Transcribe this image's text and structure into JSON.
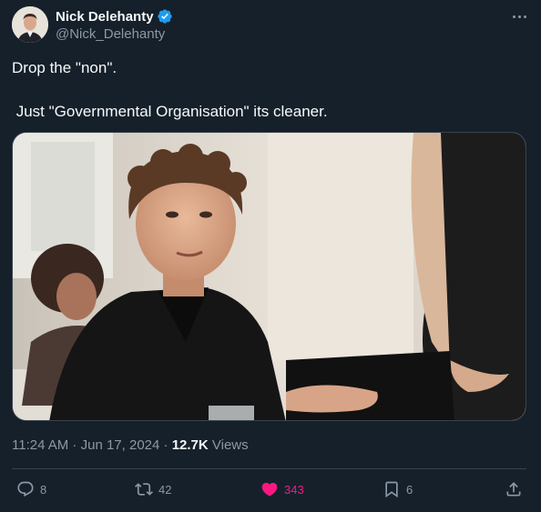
{
  "author": {
    "display_name": "Nick Delehanty",
    "handle": "@Nick_Delehanty",
    "verified_icon": "verified-badge-icon"
  },
  "post": {
    "line1": "Drop the \"non\".",
    "line2": " Just \"Governmental Organisation\" its cleaner."
  },
  "meta": {
    "time": "11:24 AM",
    "separator1": " · ",
    "date": "Jun 17, 2024",
    "separator2": " · ",
    "views_count": "12.7K",
    "views_label": " Views"
  },
  "actions": {
    "replies": "8",
    "reposts": "42",
    "likes": "343",
    "bookmarks": "6"
  },
  "colors": {
    "background": "#15202b",
    "like_active": "#f91880",
    "verified": "#1d9bf0",
    "muted_text": "#8b98a5"
  }
}
